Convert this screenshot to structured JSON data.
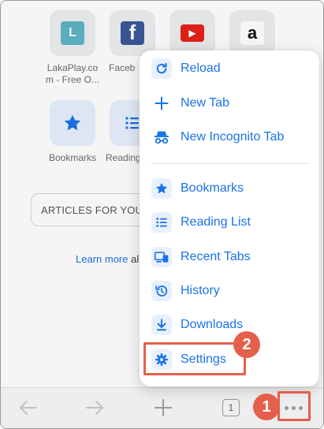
{
  "shortcuts": [
    {
      "label": "LakaPlay.co\nm - Free O...",
      "glyph": "L",
      "icon": "lakaplay-icon"
    },
    {
      "label": "Faceb",
      "glyph": "f",
      "icon": "facebook-icon"
    },
    {
      "label": "",
      "glyph": "▶",
      "icon": "youtube-icon"
    },
    {
      "label": "",
      "glyph": "a",
      "icon": "amazon-icon"
    }
  ],
  "quick_actions": [
    {
      "label": "Bookmarks",
      "icon": "star-icon"
    },
    {
      "label": "Reading",
      "icon": "reading-list-icon"
    }
  ],
  "articles": {
    "label": "ARTICLES FOR YOU"
  },
  "learn": {
    "link": "Learn more",
    "rest": " al"
  },
  "menu": {
    "items": [
      {
        "label": "Reload",
        "icon": "reload-icon"
      },
      {
        "label": "New Tab",
        "icon": "plus-icon"
      },
      {
        "label": "New Incognito Tab",
        "icon": "incognito-icon"
      },
      {
        "label": "Bookmarks",
        "icon": "star-icon"
      },
      {
        "label": "Reading List",
        "icon": "reading-list-icon"
      },
      {
        "label": "Recent Tabs",
        "icon": "recent-tabs-icon"
      },
      {
        "label": "History",
        "icon": "history-icon"
      },
      {
        "label": "Downloads",
        "icon": "download-icon"
      },
      {
        "label": "Settings",
        "icon": "gear-icon"
      }
    ]
  },
  "toolbar": {
    "tab_count": "1"
  },
  "annotations": {
    "step1": "1",
    "step2": "2"
  },
  "colors": {
    "accent": "#1a73e8",
    "annotation": "#e4604d",
    "icon_bg": "#e8f0fe"
  }
}
